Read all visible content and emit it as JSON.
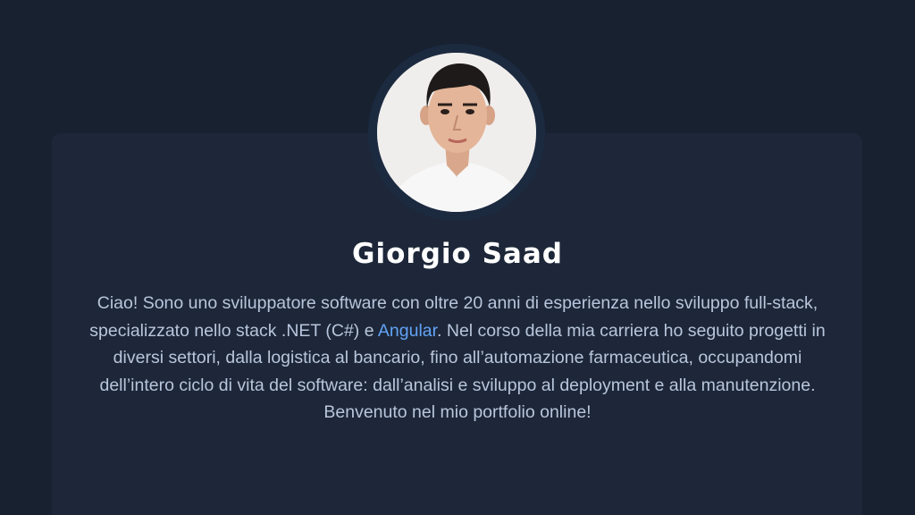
{
  "profile": {
    "name": "Giorgio Saad",
    "avatar_icon": "profile-photo",
    "bio": {
      "part1": "Ciao! Sono uno sviluppatore software con oltre 20 anni di esperienza nello sviluppo full-stack, specializzato nello stack .NET (C#) e ",
      "link": "Angular",
      "part2": ". Nel corso della mia carriera ho seguito progetti in diversi settori, dalla logistica al bancario, fino all’automazione farmaceutica, occupandomi dell’intero ciclo di vita del software: dall’analisi e sviluppo al deployment e alla manutenzione. Benvenuto nel mio portfolio online!"
    }
  },
  "colors": {
    "background": "#182130",
    "card": "#1d2739",
    "link": "#62a3f5",
    "text": "#b9c5dc"
  }
}
